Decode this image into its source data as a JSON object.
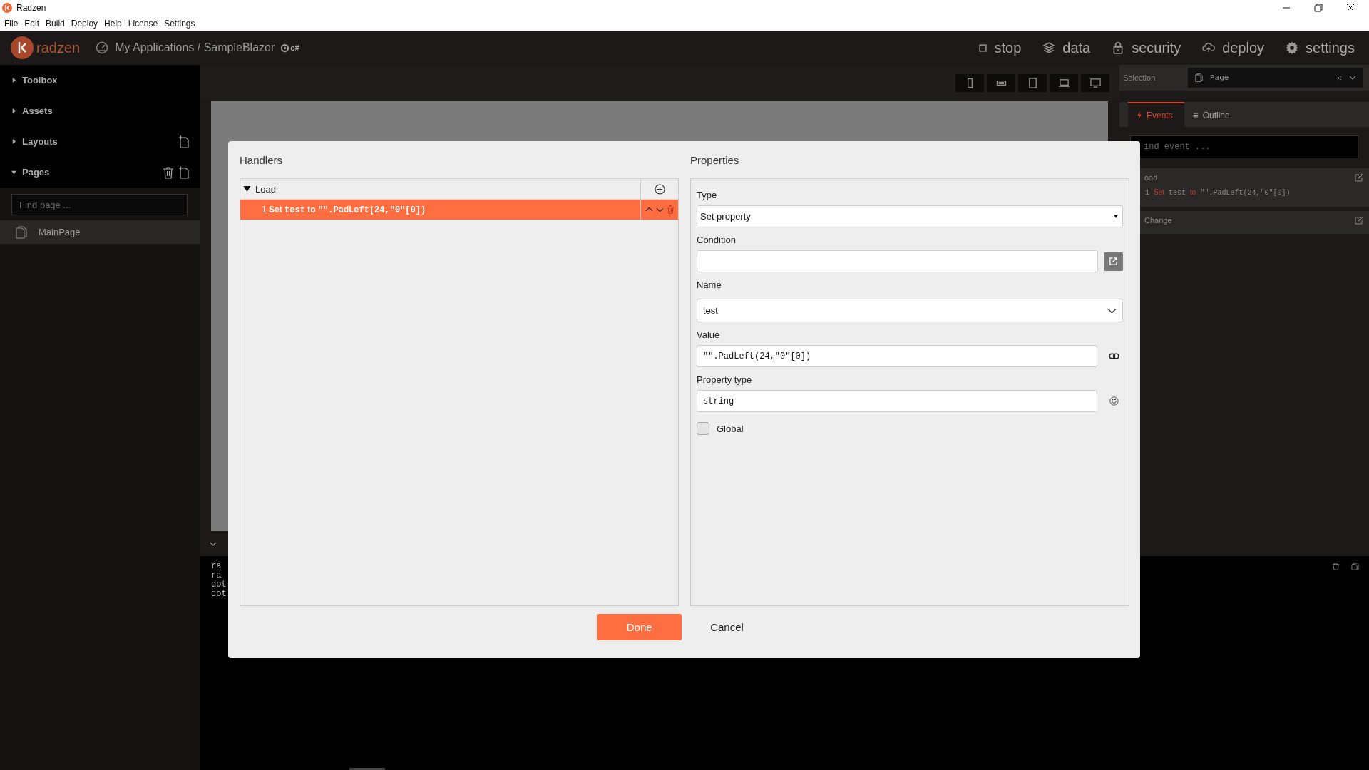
{
  "window": {
    "title": "Radzen"
  },
  "menu": [
    "File",
    "Edit",
    "Build",
    "Deploy",
    "Help",
    "License",
    "Settings"
  ],
  "header": {
    "logo": "radzen",
    "breadcrumb": "My Applications / SampleBlazor",
    "badge": "c#",
    "nav": [
      {
        "kind": "stop",
        "label": "stop"
      },
      {
        "kind": "data",
        "label": "data"
      },
      {
        "kind": "security",
        "label": "security"
      },
      {
        "kind": "deploy",
        "label": "deploy"
      },
      {
        "kind": "settings",
        "label": "settings"
      }
    ]
  },
  "sidebar": {
    "sections": [
      {
        "label": "Toolbox",
        "expanded": false
      },
      {
        "label": "Assets",
        "expanded": false
      },
      {
        "label": "Layouts",
        "expanded": false
      },
      {
        "label": "Pages",
        "expanded": true
      }
    ],
    "search": {
      "placeholder": "Find page ..."
    },
    "pages": [
      {
        "label": "MainPage",
        "selected": true
      }
    ]
  },
  "right_panel": {
    "selection_label": "Selection",
    "selection": "Page",
    "tabs": [
      {
        "label": "Events",
        "selected": true
      },
      {
        "label": "Outline",
        "selected": false
      }
    ],
    "search": {
      "placeholder": "ind event ..."
    },
    "events": [
      {
        "name": "oad",
        "handlers": [
          {
            "number": "1",
            "action": "Set",
            "target": "test",
            "op": "to",
            "value": "\"\".PadLeft(24,\"0\"[0])"
          }
        ]
      },
      {
        "name": "Change"
      }
    ]
  },
  "output": {
    "lines": [
      "ra",
      "ra",
      "dot",
      "dot"
    ]
  },
  "dialog": {
    "handlers_title": "Handlers",
    "properties_title": "Properties",
    "event": {
      "name": "Load",
      "expanded": true
    },
    "handlers": [
      {
        "number": "1",
        "action": "Set",
        "target": "test",
        "op": "to",
        "value": "\"\".PadLeft(24,\"0\"[0])",
        "selected": true
      }
    ],
    "fields": [
      {
        "kind": "select",
        "label": "Type",
        "value": "Set property"
      },
      {
        "kind": "expression",
        "label": "Condition"
      },
      {
        "kind": "dropdown",
        "label": "Name",
        "value": "test"
      },
      {
        "kind": "binding",
        "label": "Value",
        "value": "\"\".PadLeft(24,\"0\"[0])"
      },
      {
        "kind": "refresh",
        "label": "Property type",
        "value": "string"
      },
      {
        "kind": "checkbox",
        "label": "Global",
        "checked": false
      }
    ],
    "buttons": [
      {
        "kind": "primary",
        "label": "Done"
      },
      {
        "kind": "flat",
        "label": "Cancel"
      }
    ]
  }
}
